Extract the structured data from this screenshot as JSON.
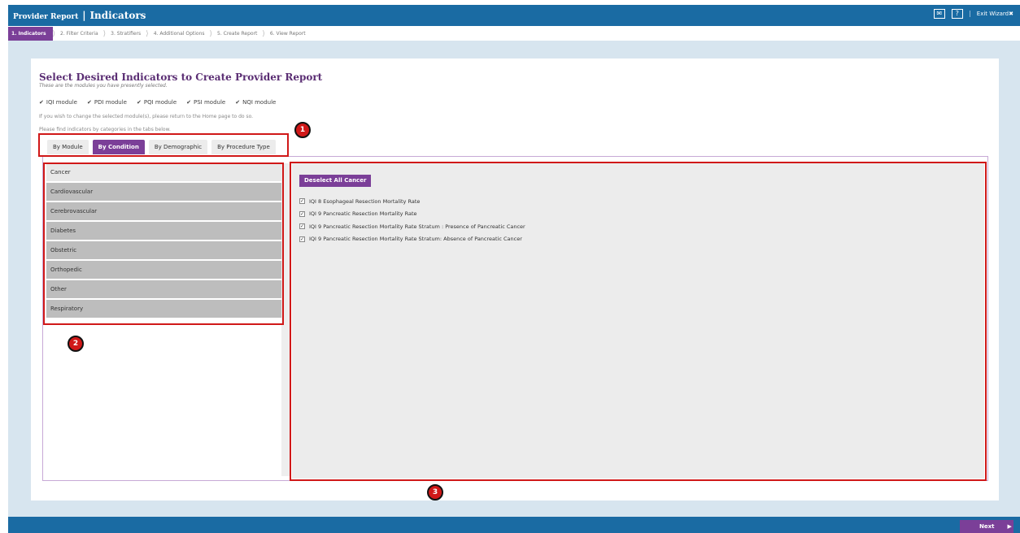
{
  "header": {
    "app_name": "Provider Report",
    "separator": "|",
    "section": "Indicators",
    "mail_icon": "envelope-icon",
    "help_label": "?",
    "exit_label": "Exit Wizard"
  },
  "wizard": {
    "steps": [
      "1. Indicators",
      "2. Filter Criteria",
      "3. Stratifiers",
      "4. Additional Options",
      "5. Create Report",
      "6. View Report"
    ],
    "active_index": 0
  },
  "main": {
    "title": "Select Desired Indicators to Create Provider Report",
    "subtitle": "These are the modules you have presently selected.",
    "modules": [
      "IQI module",
      "PDI module",
      "PQI module",
      "PSI module",
      "NQI module"
    ],
    "change_note": "If you wish to change the selected module(s), please return to the Home page to do so.",
    "tabs_note": "Please find indicators by categories in the tabs below.",
    "tabs": [
      "By Module",
      "By Condition",
      "By Demographic",
      "By Procedure Type"
    ],
    "active_tab": "By Condition",
    "conditions": [
      "Cancer",
      "Cardiovascular",
      "Cerebrovascular",
      "Diabetes",
      "Obstetric",
      "Orthopedic",
      "Other",
      "Respiratory"
    ],
    "active_condition": "Cancer",
    "deselect_label": "Deselect All Cancer",
    "indicators": [
      "IQI 8 Esophageal Resection Mortality Rate",
      "IQI 9 Pancreatic Resection Mortality Rate",
      "IQI 9 Pancreatic Resection Mortality Rate Stratum : Presence of Pancreatic Cancer",
      "IQI 9 Pancreatic Resection Mortality Rate Stratum: Absence of Pancreatic Cancer"
    ]
  },
  "footer": {
    "next_label": "Next"
  },
  "annotations": [
    "1",
    "2",
    "3"
  ],
  "colors": {
    "brand_blue": "#1a6ba3",
    "accent_purple": "#7b3f98",
    "highlight_red": "#d01818"
  }
}
